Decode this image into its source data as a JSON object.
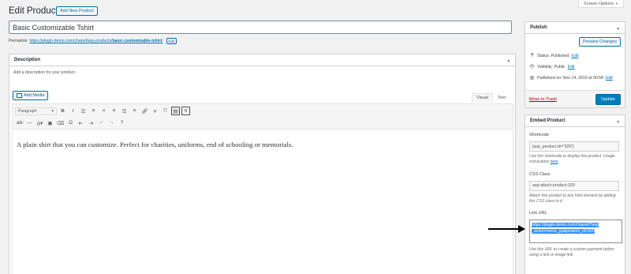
{
  "header": {
    "page_title": "Edit Product",
    "add_new_label": "Add New Product",
    "screen_options_label": "Screen Options"
  },
  "post": {
    "title_value": "Basic Customizable Tshirt",
    "permalink_label": "Permalink:",
    "permalink_base": "https://plugin-demo.com/chanel/asp-products/",
    "permalink_slug": "basic-customizable-tshirt",
    "permalink_trail": "/",
    "permalink_edit_label": "Edit"
  },
  "description_box": {
    "title": "Description",
    "hint": "Add a description for your product.",
    "add_media_label": "Add Media",
    "tab_visual": "Visual",
    "tab_text": "Text",
    "format_select_value": "Paragraph",
    "content": "A plain shirt that you can customize. Perfect for charities, uniforms, end of schooling or memorials."
  },
  "toolbar_icons": {
    "row1": [
      "bold-icon",
      "italic-icon",
      "bullet-list-icon",
      "numbered-list-icon",
      "blockquote-icon",
      "align-left-icon",
      "align-center-icon",
      "align-right-icon",
      "link-icon",
      "unlink-icon",
      "fullscreen-icon",
      "toolbar-toggle-icon",
      "shortcode-icon"
    ],
    "row2": [
      "strikethrough-icon",
      "horizontal-line-icon",
      "text-color-icon",
      "paste-text-icon",
      "clear-formatting-icon",
      "special-character-icon",
      "outdent-icon",
      "indent-icon",
      "undo-icon",
      "redo-icon",
      "help-icon"
    ]
  },
  "publish_box": {
    "title": "Publish",
    "preview_label": "Preview Changes",
    "status_label": "Status: Published",
    "status_edit": "Edit",
    "visibility_label": "Visibility: Public",
    "visibility_edit": "Edit",
    "published_label": "Published on: Nov 14, 2019 at 00:58",
    "published_edit": "Edit",
    "trash_label": "Move to Trash",
    "update_label": "Update"
  },
  "embed_box": {
    "title": "Embed Product",
    "shortcode_label": "Shortcode",
    "shortcode_value": "[asp_product id=\"329\"]",
    "shortcode_help": "Use this shortcode to display this product. Usage instructions",
    "shortcode_help_link": "here",
    "css_class_label": "CSS Class",
    "css_class_value": "asp-attach-product-329",
    "css_class_help": "Attach this product to any html element by adding this CSS class to it.",
    "link_url_label": "Link URL",
    "link_url_line1": "https://plugin-demo.com/chanel/?asp",
    "link_url_line2": "_action=show_pp&product_id=329",
    "link_url_help": "Use this URL to create a custom payment button using a text or image link."
  },
  "colors": {
    "accent": "#0073aa",
    "primary_button": "#007cba",
    "trash": "#a00000",
    "selection": "#3390ff"
  }
}
